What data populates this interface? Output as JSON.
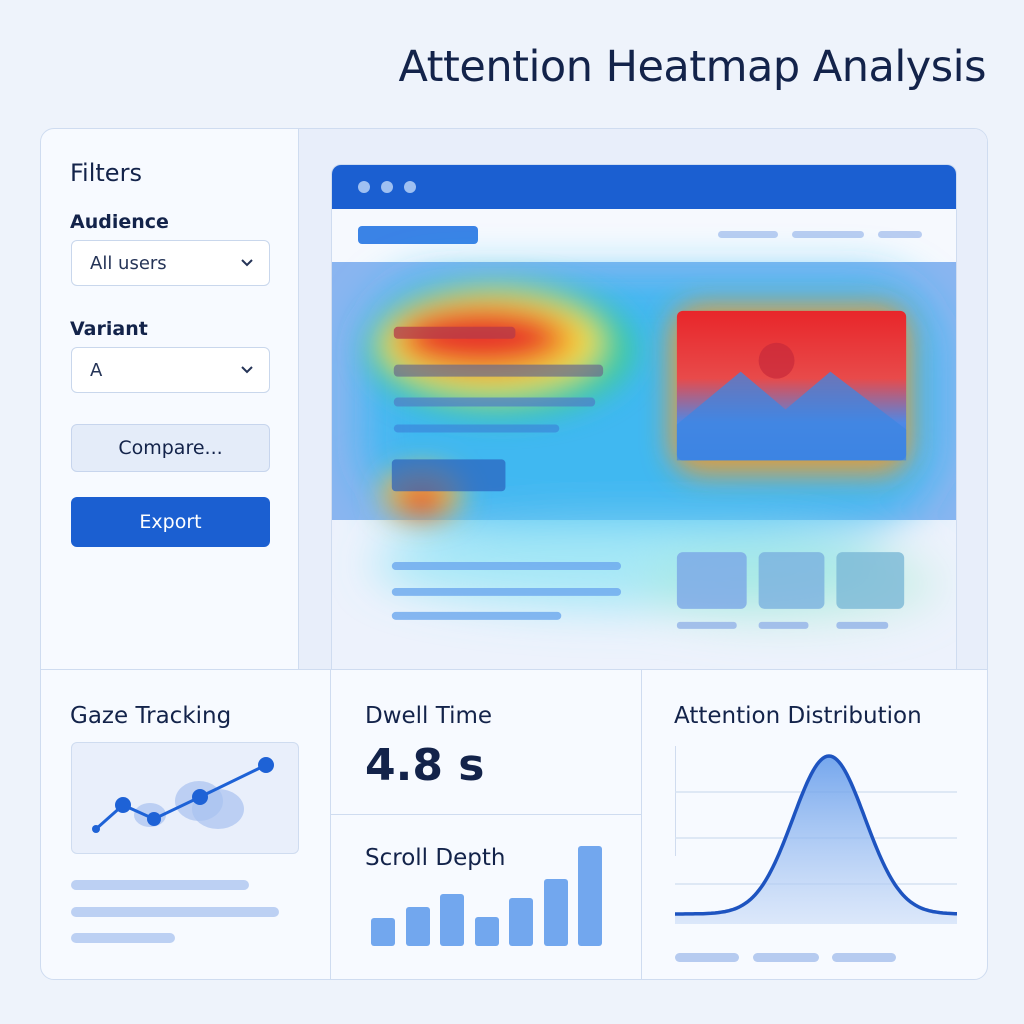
{
  "title": "Attention Heatmap Analysis",
  "sidebar": {
    "title": "Filters",
    "audience": {
      "label": "Audience",
      "value": "All users"
    },
    "variant": {
      "label": "Variant",
      "value": "A"
    },
    "compare_label": "Compare...",
    "export_label": "Export"
  },
  "panels": {
    "gaze": {
      "title": "Gaze Tracking"
    },
    "dwell": {
      "title": "Dwell Time",
      "value": "4.8 s"
    },
    "scroll": {
      "title": "Scroll Depth",
      "values": [
        2.1,
        2.9,
        3.9,
        2.2,
        3.6,
        5.0,
        7.5
      ]
    },
    "distribution": {
      "title": "Attention Distribution"
    }
  },
  "colors": {
    "accent": "#1b5fd1",
    "text": "#13234a",
    "bar": "#72a7ee"
  },
  "icons": {
    "dropdown": "chevron-down-icon"
  }
}
